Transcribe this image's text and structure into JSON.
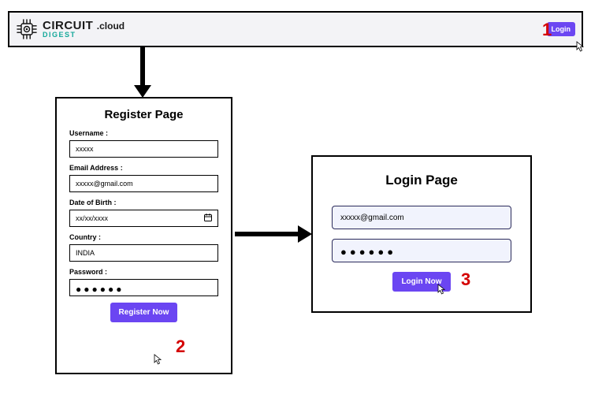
{
  "header": {
    "brand_top": "CIRCUIT",
    "brand_cloud": ".cloud",
    "brand_bottom": "DIGEST",
    "login_btn": "Login"
  },
  "annotations": {
    "one": "1",
    "two": "2",
    "three": "3"
  },
  "register": {
    "title": "Register Page",
    "username_label": "Username :",
    "username_value": "xxxxx",
    "email_label": "Email Address :",
    "email_value": "xxxxx@gmail.com",
    "dob_label": "Date of Birth :",
    "dob_value": "xx/xx/xxxx",
    "country_label": "Country :",
    "country_value": "INDIA",
    "password_label": "Password :",
    "password_value": "●●●●●●",
    "submit": "Register Now"
  },
  "login": {
    "title": "Login Page",
    "email_value": "xxxxx@gmail.com",
    "password_value": "●●●●●●",
    "submit": "Login Now"
  }
}
